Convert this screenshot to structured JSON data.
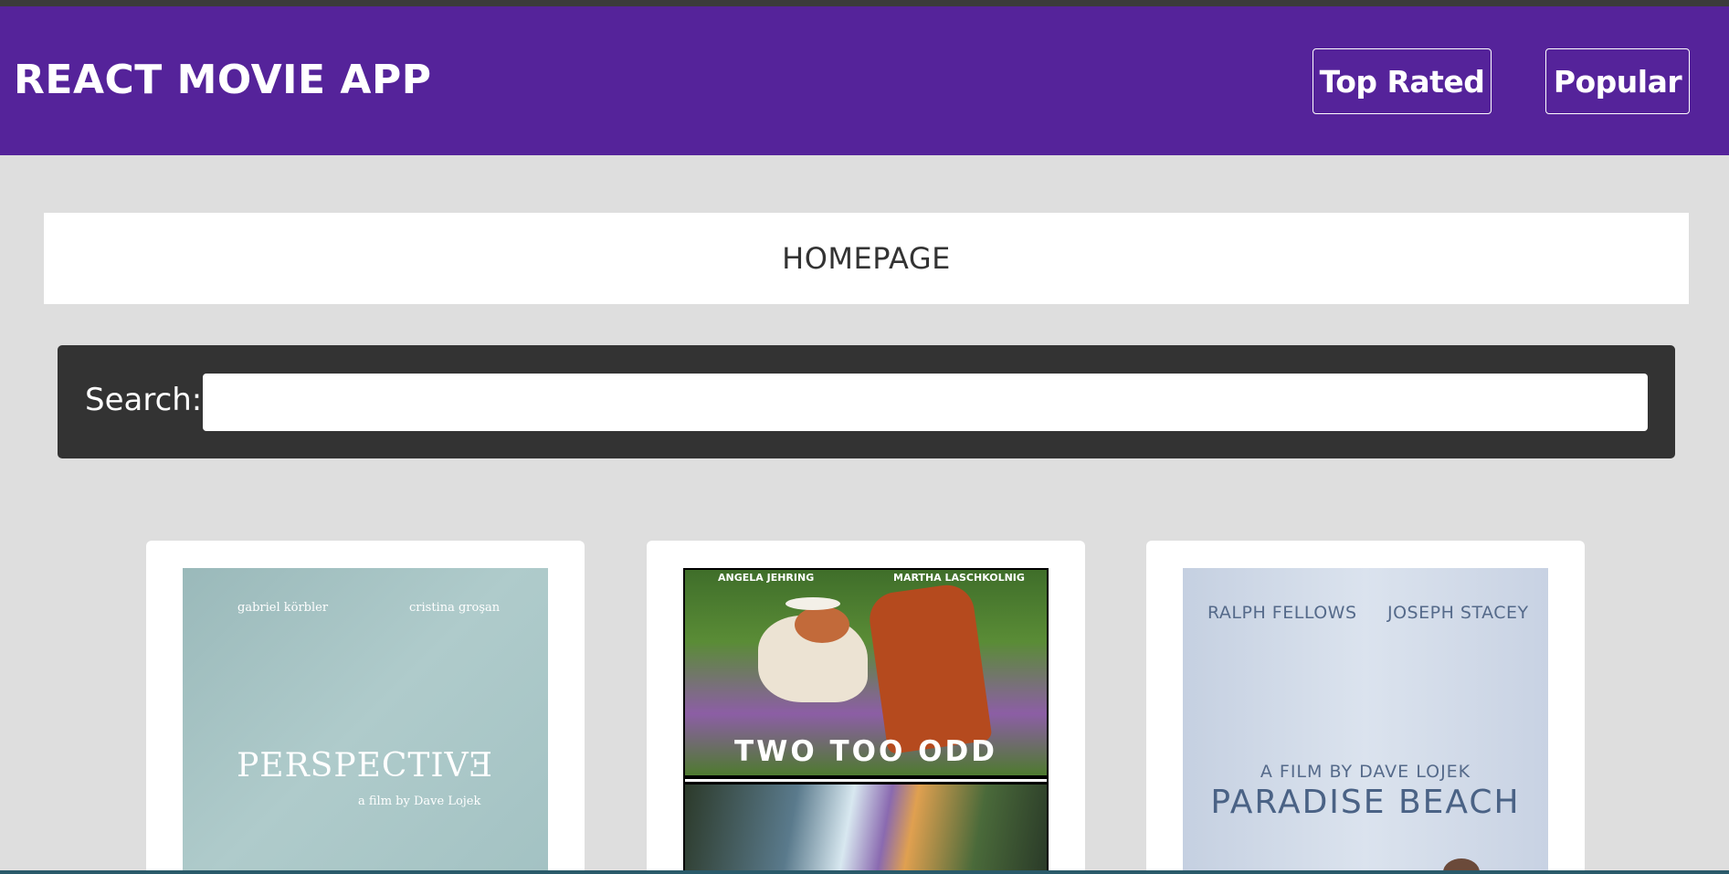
{
  "header": {
    "app_title": "REACT MOVIE APP",
    "nav": [
      {
        "label": "Top Rated"
      },
      {
        "label": "Popular"
      }
    ]
  },
  "main": {
    "page_heading": "HOMEPAGE",
    "search": {
      "label": "Search:",
      "value": "",
      "placeholder": ""
    },
    "movies": [
      {
        "poster_credits": [
          "gabriel körbler",
          "cristina groşan"
        ],
        "poster_title": "PERSPECTIVƎ",
        "poster_subtitle": "a film by Dave Lojek"
      },
      {
        "poster_credits": [
          "ANGELA JEHRING",
          "MARTHA LASCHKOLNIG"
        ],
        "poster_title": "TWO TOO ODD"
      },
      {
        "poster_credits": [
          "RALPH FELLOWS",
          "JOSEPH STACEY"
        ],
        "poster_subtitle": "A FILM BY DAVE LOJEK",
        "poster_title": "PARADISE BEACH"
      }
    ]
  },
  "colors": {
    "header_bg": "#55239a",
    "page_bg": "#dedede",
    "search_bar_bg": "#333333"
  }
}
